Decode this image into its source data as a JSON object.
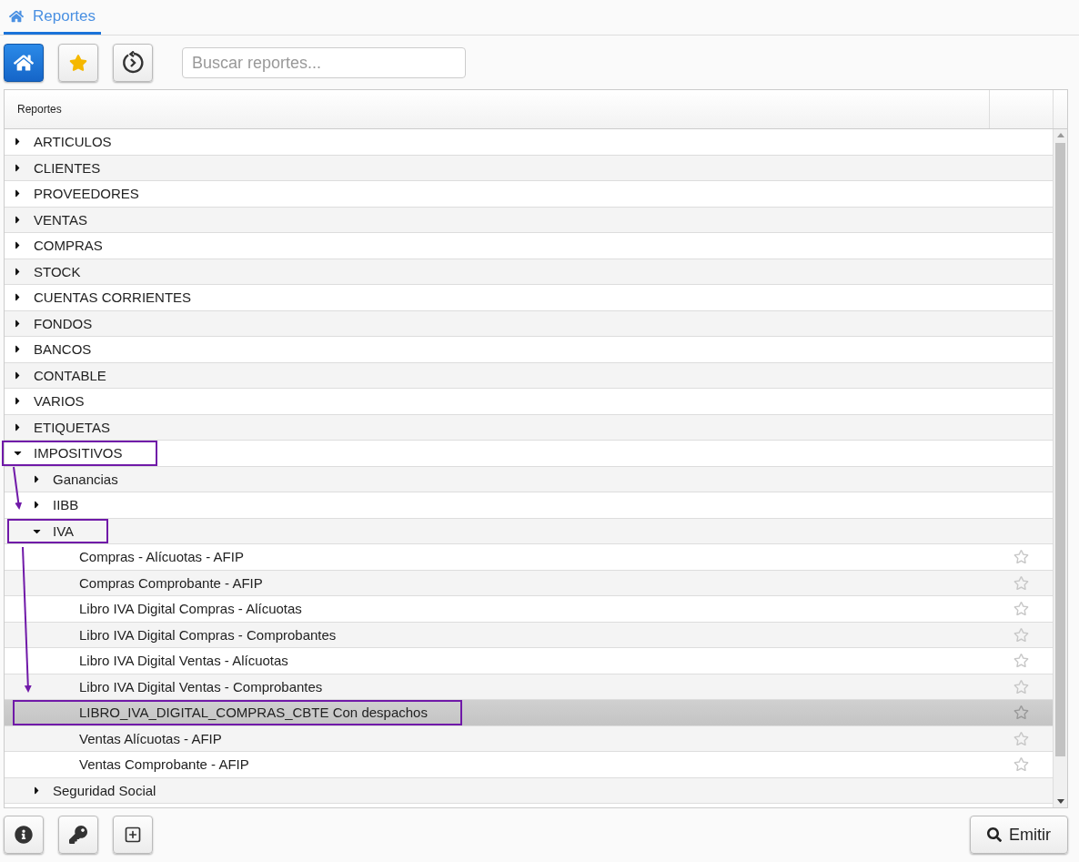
{
  "tab": {
    "label": "Reportes",
    "selected": true
  },
  "toolbar": {
    "buttons": [
      {
        "kind": "home",
        "selected": true
      },
      {
        "kind": "favorites",
        "selected": false
      },
      {
        "kind": "history",
        "selected": false
      }
    ],
    "search": {
      "placeholder": "Buscar reportes..."
    }
  },
  "grid": {
    "columns": [
      "Reportes"
    ],
    "tree": [
      {
        "label": "ARTICULOS",
        "expanded": false
      },
      {
        "label": "CLIENTES",
        "expanded": false
      },
      {
        "label": "PROVEEDORES",
        "expanded": false
      },
      {
        "label": "VENTAS",
        "expanded": false
      },
      {
        "label": "COMPRAS",
        "expanded": false
      },
      {
        "label": "STOCK",
        "expanded": false
      },
      {
        "label": "CUENTAS CORRIENTES",
        "expanded": false
      },
      {
        "label": "FONDOS",
        "expanded": false
      },
      {
        "label": "BANCOS",
        "expanded": false
      },
      {
        "label": "CONTABLE",
        "expanded": false
      },
      {
        "label": "VARIOS",
        "expanded": false
      },
      {
        "label": "ETIQUETAS",
        "expanded": false
      },
      {
        "label": "IMPOSITIVOS",
        "expanded": true,
        "highlighted": true,
        "children": [
          {
            "label": "Ganancias",
            "expanded": false
          },
          {
            "label": "IIBB",
            "expanded": false
          },
          {
            "label": "IVA",
            "expanded": true,
            "highlighted": true,
            "children": [
              {
                "label": "Compras - Alícuotas - AFIP",
                "kind": "report",
                "favorite": false,
                "selected": false
              },
              {
                "label": "Compras Comprobante - AFIP",
                "kind": "report",
                "favorite": false,
                "selected": false
              },
              {
                "label": "Libro IVA Digital Compras - Alícuotas",
                "kind": "report",
                "favorite": false,
                "selected": false
              },
              {
                "label": "Libro IVA Digital Compras - Comprobantes",
                "kind": "report",
                "favorite": false,
                "selected": false
              },
              {
                "label": "Libro IVA Digital Ventas - Alícuotas",
                "kind": "report",
                "favorite": false,
                "selected": false
              },
              {
                "label": "Libro IVA Digital Ventas - Comprobantes",
                "kind": "report",
                "favorite": false,
                "selected": false
              },
              {
                "label": "LIBRO_IVA_DIGITAL_COMPRAS_CBTE Con despachos",
                "kind": "report",
                "favorite": false,
                "selected": true,
                "highlighted": true
              },
              {
                "label": "Ventas Alícuotas - AFIP",
                "kind": "report",
                "favorite": false,
                "selected": false
              },
              {
                "label": "Ventas Comprobante - AFIP",
                "kind": "report",
                "favorite": false,
                "selected": false
              }
            ]
          },
          {
            "label": "Seguridad Social",
            "expanded": false
          }
        ]
      }
    ]
  },
  "footer": {
    "buttons": [
      {
        "kind": "info"
      },
      {
        "kind": "key"
      },
      {
        "kind": "add"
      }
    ],
    "emit": {
      "label": "Emitir"
    }
  }
}
